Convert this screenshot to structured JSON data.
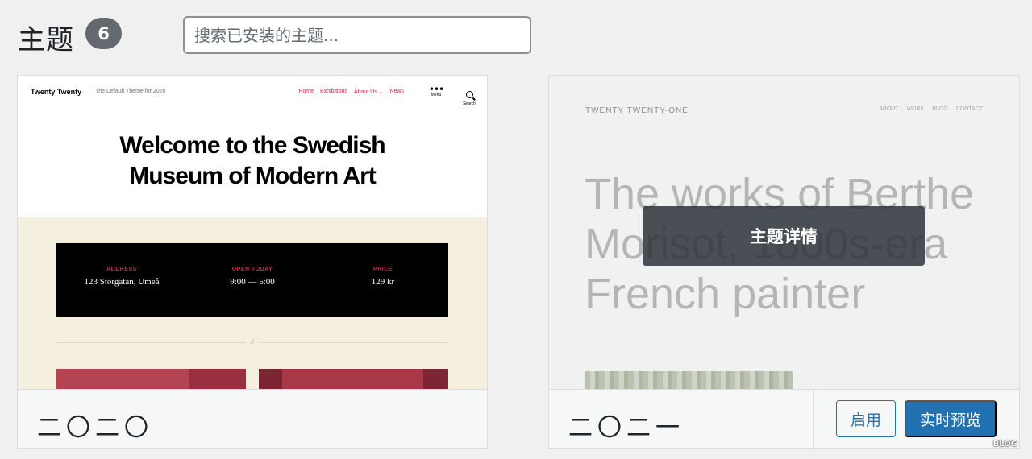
{
  "header": {
    "title": "主题",
    "count": "6",
    "search_placeholder": "搜索已安装的主题..."
  },
  "themes": [
    {
      "name": "二〇二〇",
      "preview": {
        "site_title": "Twenty Twenty",
        "tagline": "The Default Theme for 2020",
        "nav": [
          "Home",
          "Exhibitions",
          "About Us ⌄",
          "News"
        ],
        "menu_label": "Menu",
        "search_label": "Search",
        "hero_line1": "Welcome to the Swedish",
        "hero_line2": "Museum of Modern Art",
        "info": [
          {
            "label": "ADDRESS",
            "value": "123 Storgatan, Umeå"
          },
          {
            "label": "OPEN TODAY",
            "value": "9:00 — 5:00"
          },
          {
            "label": "PRICE",
            "value": "129 kr"
          }
        ],
        "separator_mark": "//"
      }
    },
    {
      "name": "二〇二一",
      "preview": {
        "site_title": "TWENTY TWENTY-ONE",
        "nav": [
          "ABOUT",
          "WORK",
          "BLOG",
          "CONTACT"
        ],
        "hero_line1": "The works of Berthe",
        "hero_line2": "Morisot, 1800s-era",
        "hero_line3": "French painter"
      },
      "details_label": "主题详情",
      "activate_label": "启用",
      "live_preview_label": "实时预览"
    }
  ],
  "watermark": "BLOG",
  "colors": {
    "accent": "#2271b1",
    "tt_accent": "#cd2653",
    "badge_bg": "#646970"
  }
}
